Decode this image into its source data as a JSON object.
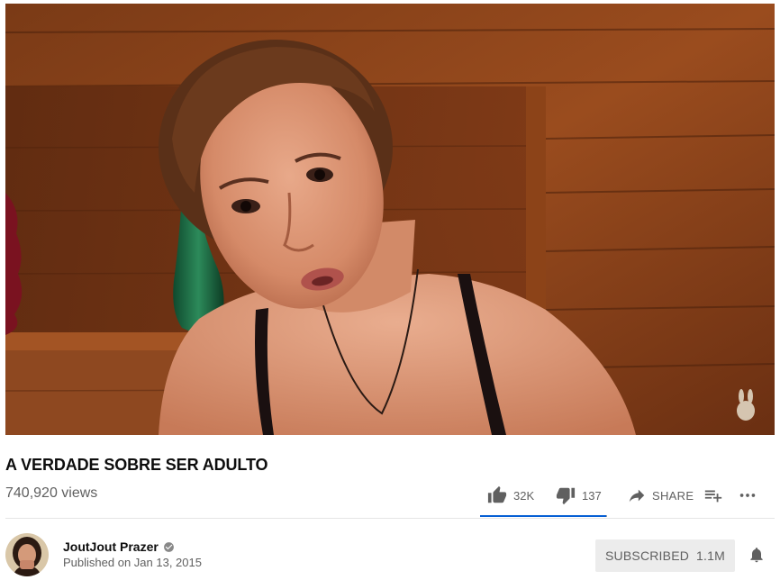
{
  "video": {
    "title": "A VERDADE SOBRE SER ADULTO",
    "views": "740,920 views"
  },
  "actions": {
    "like_count": "32K",
    "dislike_count": "137",
    "share_label": "SHARE",
    "like_ratio": 0.996
  },
  "channel": {
    "name": "JoutJout Prazer",
    "published": "Published on Jan 13, 2015",
    "verified": true
  },
  "subscribe": {
    "label": "SUBSCRIBED",
    "count": "1.1M"
  },
  "icons": {
    "like": "thumbs-up-icon",
    "dislike": "thumbs-down-icon",
    "share": "share-arrow-icon",
    "add": "add-to-playlist-icon",
    "more": "more-horizontal-icon",
    "bell": "bell-icon",
    "verified": "verified-check-icon"
  },
  "colors": {
    "accent_blue": "#065fd4",
    "muted_text": "#606060",
    "subscribed_bg": "#ececec"
  }
}
